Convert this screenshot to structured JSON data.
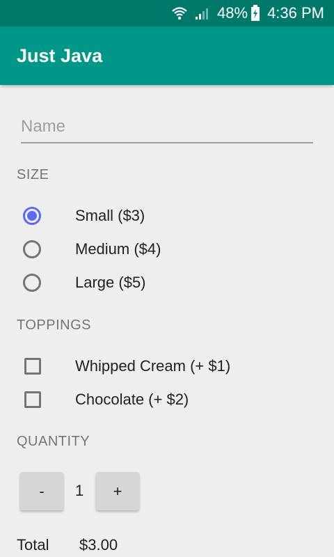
{
  "status_bar": {
    "battery_percent": "48%",
    "time": "4:36 PM",
    "icons": [
      "wifi-icon",
      "signal-icon",
      "battery-charging-icon"
    ]
  },
  "app_bar": {
    "title": "Just Java"
  },
  "name_field": {
    "placeholder": "Name",
    "value": ""
  },
  "size": {
    "header": "SIZE",
    "options": [
      {
        "label": "Small ($3)",
        "selected": true
      },
      {
        "label": "Medium ($4)",
        "selected": false
      },
      {
        "label": "Large ($5)",
        "selected": false
      }
    ]
  },
  "toppings": {
    "header": "TOPPINGS",
    "options": [
      {
        "label": "Whipped Cream (+ $1)",
        "checked": false
      },
      {
        "label": "Chocolate (+ $2)",
        "checked": false
      }
    ]
  },
  "quantity": {
    "header": "QUANTITY",
    "decrement_label": "-",
    "increment_label": "+",
    "value": "1"
  },
  "total": {
    "label": "Total",
    "value": "$3.00"
  },
  "colors": {
    "status_bar": "#00796b",
    "app_bar": "#009688",
    "accent": "#5c6bf0",
    "background": "#eeeeee"
  }
}
